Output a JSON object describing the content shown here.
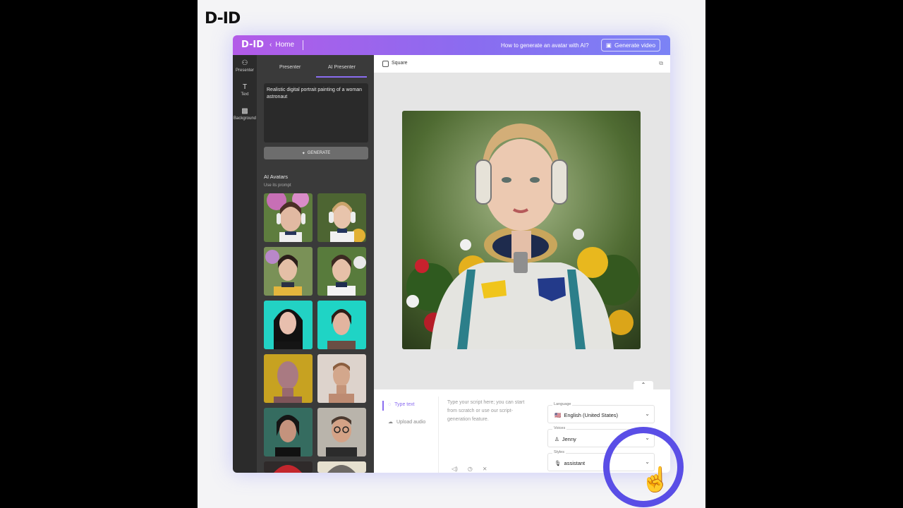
{
  "brand": "D-ID",
  "topbar": {
    "logo": "D-ID",
    "home_label": "Home",
    "howto_label": "How to generate an avatar with AI?",
    "generate_video_label": "Generate video"
  },
  "rail": {
    "items": [
      {
        "label": "Presenter",
        "icon": "person-icon"
      },
      {
        "label": "Text",
        "icon": "text-icon"
      },
      {
        "label": "Background",
        "icon": "background-icon"
      }
    ]
  },
  "panel": {
    "tabs": [
      "Presenter",
      "AI Presenter"
    ],
    "active_tab": "AI Presenter",
    "prompt_text": "Realistic digital portrait painting of a woman astronaut",
    "generate_label": "GENERATE",
    "section_title": "AI Avatars",
    "section_sub": "Use its prompt",
    "avatars": [
      "astronaut-purple-flowers",
      "astronaut-blonde-headphones",
      "astronaut-dark-hair",
      "astronaut-garden",
      "avatar-black-hair-teal",
      "avatar-teal-bg",
      "avatar-bald-yellow",
      "avatar-man-beige",
      "avatar-woman-dark",
      "avatar-man-glasses",
      "avatar-red-hair",
      "avatar-gray-hair"
    ]
  },
  "main": {
    "square_label": "Square",
    "script_placeholder": "Type your script here; you can start from scratch or use our script-generation feature.",
    "input_options": {
      "type_text": "Type text",
      "upload_audio": "Upload audio"
    },
    "language": {
      "label": "Language",
      "value": "English (United States)",
      "flag": "🇺🇸"
    },
    "voices": {
      "label": "Voices",
      "value": "Jenny"
    },
    "styles": {
      "label": "Styles",
      "value": "assistant"
    }
  },
  "colors": {
    "accent": "#8a6cf0",
    "topbar_start": "#b35be8",
    "topbar_end": "#7b83f5",
    "highlight_ring": "#5a4ee6"
  }
}
